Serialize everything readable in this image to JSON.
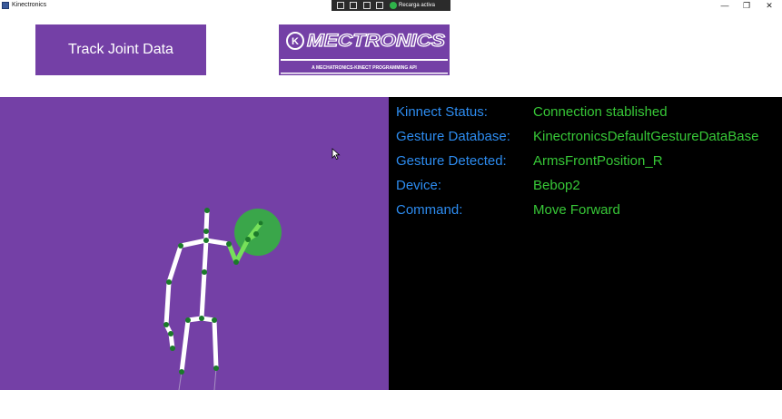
{
  "window": {
    "title": "Kinectronics",
    "controls": {
      "minimize": "—",
      "maximize": "❐",
      "close": "✕"
    }
  },
  "debug_toolbar": {
    "status_label": "Recarga activa"
  },
  "toolbar": {
    "track_button_label": "Track Joint Data"
  },
  "logo": {
    "icon_letter": "K",
    "wordmark": "MECTRONICS",
    "tagline": "A MECHATRONICS-KINECT PROGRAMMING API"
  },
  "status": {
    "rows": [
      {
        "label": "Kinnect Status:",
        "value": "Connection stablished"
      },
      {
        "label": "Gesture Database:",
        "value": "KinectronicsDefaultGestureDataBase"
      },
      {
        "label": "Gesture Detected:",
        "value": "ArmsFrontPosition_R"
      },
      {
        "label": "Device:",
        "value": "Bebop2"
      },
      {
        "label": "Command:",
        "value": "Move Forward"
      }
    ]
  },
  "colors": {
    "accent": "#7440a6",
    "status_label": "#2d8cf0",
    "status_value": "#37c837",
    "joint": "#1b7a2a",
    "hand_circle": "#3aa64a"
  }
}
